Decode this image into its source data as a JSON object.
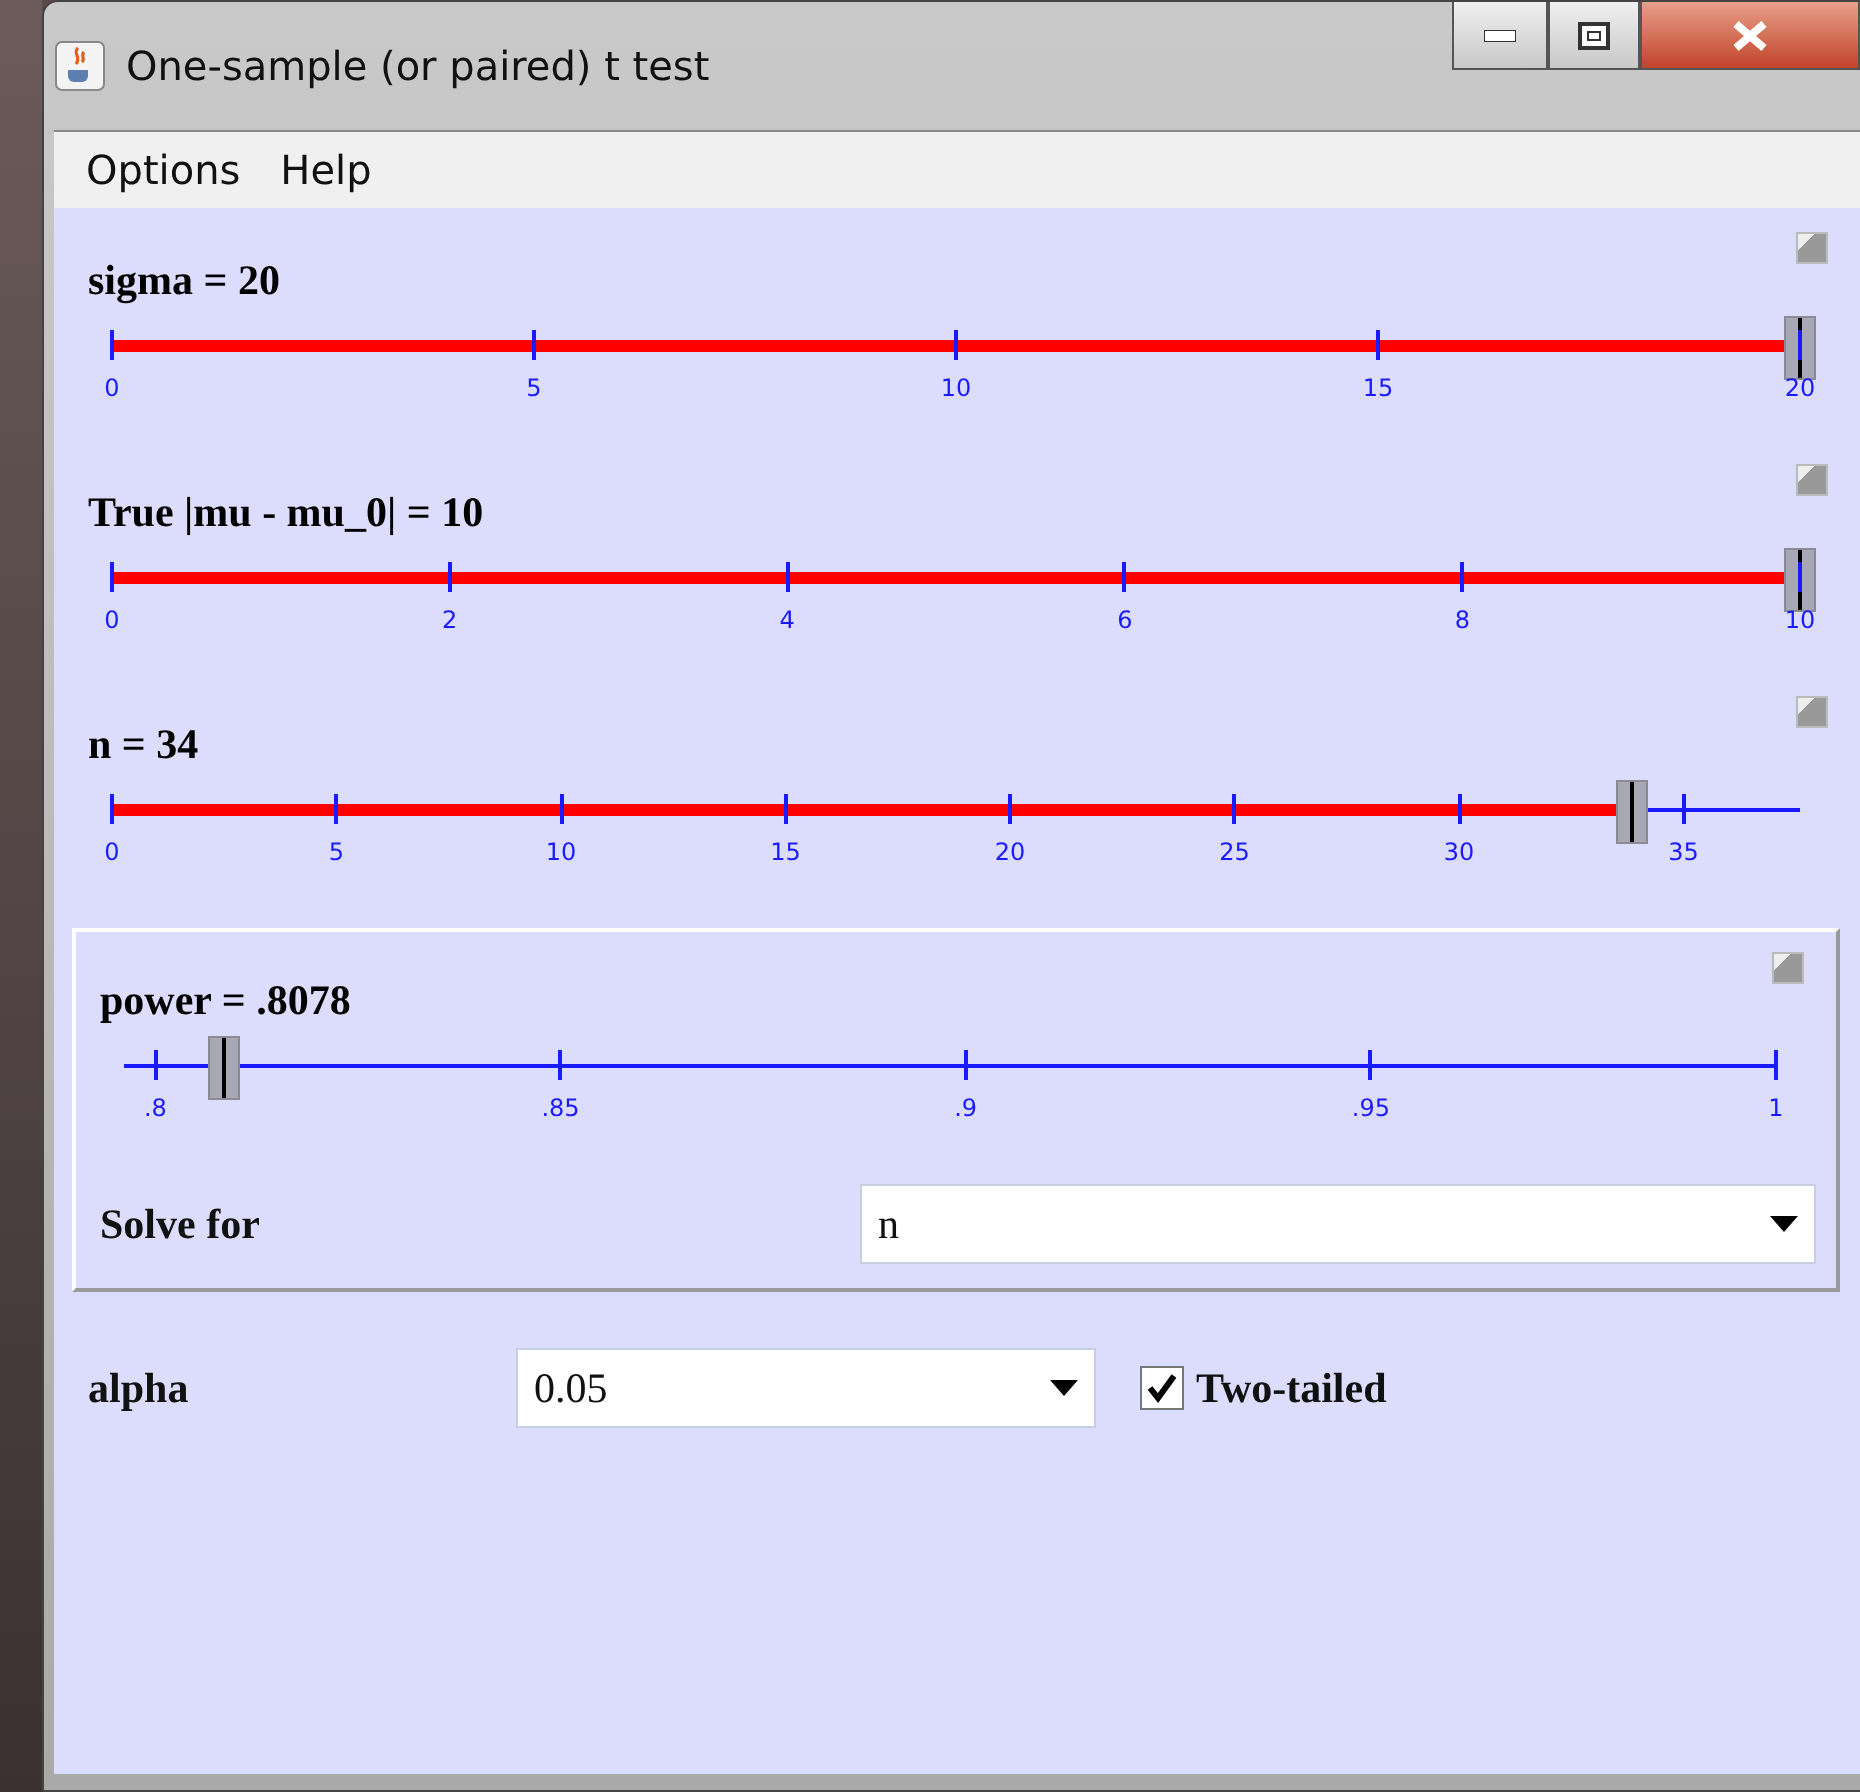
{
  "window": {
    "title": "One-sample (or paired) t test"
  },
  "menu": [
    "Options",
    "Help"
  ],
  "sliders": [
    {
      "kind": "input",
      "label": "sigma = 20",
      "level": 1,
      "ticks": [
        "0",
        "5",
        "10",
        "15",
        "20"
      ]
    },
    {
      "kind": "input",
      "label": "True |mu - mu_0| = 10",
      "level": 1,
      "ticks": [
        "0",
        "2",
        "4",
        "6",
        "8",
        "10"
      ]
    },
    {
      "kind": "input",
      "label": "n = 34",
      "level": 0.9,
      "ticks": [
        "0",
        "5",
        "10",
        "15",
        "20",
        "25",
        "30",
        "35"
      ]
    }
  ],
  "result": {
    "slider": {
      "kind": "result",
      "label": "power = .8078",
      "level": 0.06,
      "ticks": [
        ".8",
        ".85",
        ".9",
        ".95",
        "1"
      ]
    },
    "solve_for": {
      "label": "Solve for",
      "value": "n"
    }
  },
  "alpha": {
    "label": "alpha",
    "value": "0.05"
  },
  "two_tailed": {
    "label": "Two-tailed",
    "checked": true
  }
}
